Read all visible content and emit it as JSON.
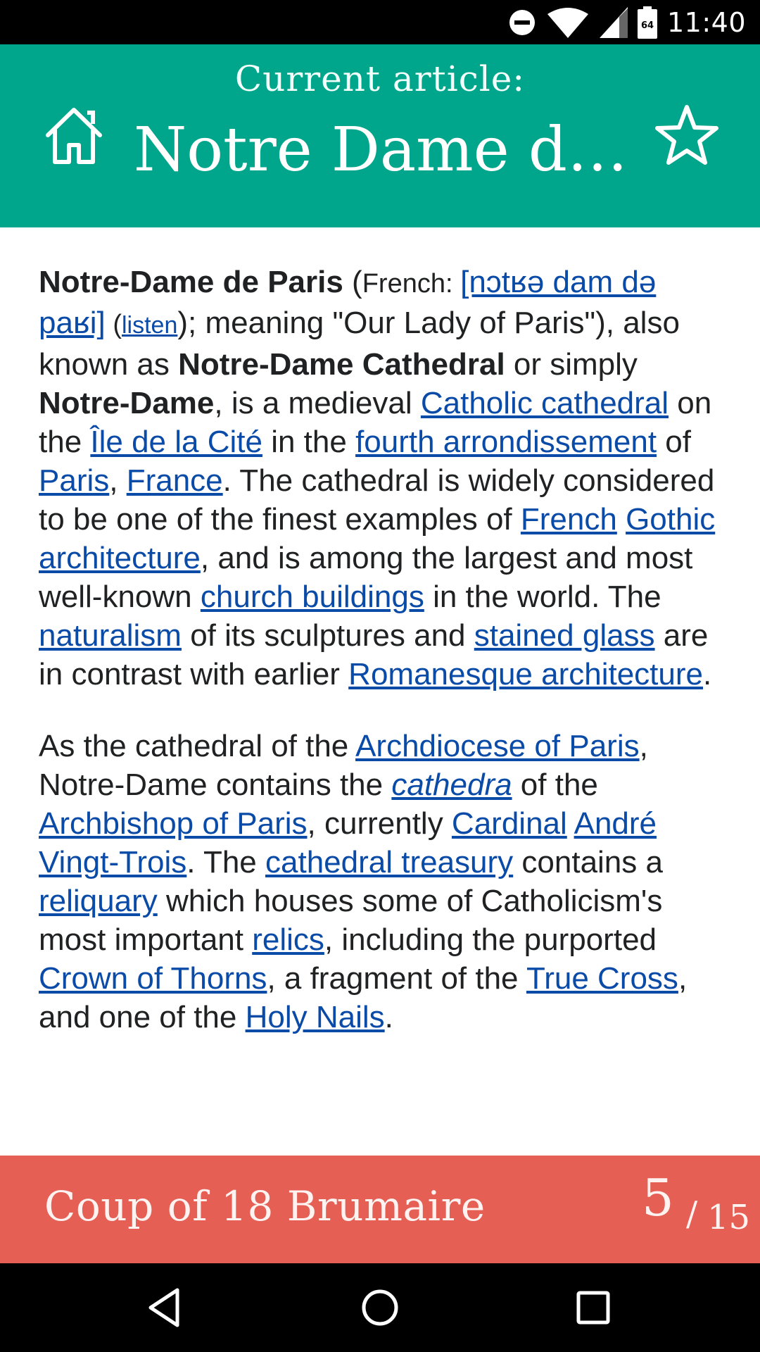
{
  "status_bar": {
    "time": "11:40",
    "icons": [
      "do-not-disturb-icon",
      "wifi-icon",
      "cell-signal-icon",
      "battery-icon"
    ],
    "battery_level": "64"
  },
  "header": {
    "subtitle": "Current article:",
    "title": "Notre Dame de ...",
    "color": "#00a68c",
    "home_icon": "home-icon",
    "favorite_icon": "star-icon"
  },
  "article": {
    "p1": {
      "s1": "Notre-Dame de Paris",
      "s2": " (",
      "s3": "French: ",
      "s4": "[nɔtʁə dam də paʁi]",
      "s5": " (",
      "s6": "listen",
      "s7": "); meaning \"Our Lady of Paris\"), also known as ",
      "s8": "Notre-Dame Cathedral",
      "s9": " or simply ",
      "s10": "Notre-Dame",
      "s11": ", is a medieval ",
      "s12": "Catholic cathedral",
      "s13": " on the ",
      "s14": "Île de la Cité",
      "s15": " in the ",
      "s16": "fourth arrondissement",
      "s17": " of ",
      "s18": "Paris",
      "s19": ", ",
      "s20": "France",
      "s21": ". The cathedral is widely considered to be one of the finest examples of ",
      "s22": "French",
      "s23": " ",
      "s24": "Gothic architecture",
      "s25": ", and is among the largest and most well-known ",
      "s26": "church buildings",
      "s27": " in the world. The ",
      "s28": "naturalism",
      "s29": " of its sculptures and ",
      "s30": "stained glass",
      "s31": " are in contrast with earlier ",
      "s32": "Romanesque architecture",
      "s33": "."
    },
    "p2": {
      "s1": "As the cathedral of the ",
      "s2": "Archdiocese of Paris",
      "s3": ", Notre-Dame contains the ",
      "s4": "cathedra",
      "s5": " of the ",
      "s6": "Archbishop of Paris",
      "s7": ", currently ",
      "s8": "Cardinal",
      "s9": " ",
      "s10": "André Vingt-Trois",
      "s11": ". The ",
      "s12": "cathedral treasury",
      "s13": " contains a ",
      "s14": "reliquary",
      "s15": " which houses some of Catholicism's most important ",
      "s16": "relics",
      "s17": ", including the purported ",
      "s18": "Crown of Thorns",
      "s19": ", a fragment of the ",
      "s20": "True Cross",
      "s21": ", and one of the ",
      "s22": "Holy Nails",
      "s23": "."
    },
    "link_color": "#0b4ba8"
  },
  "footer": {
    "target_title": "Coup of 18 Brumaire",
    "current": "5",
    "separator": "/",
    "total": "15",
    "color": "#e55f55"
  },
  "nav_bar": {
    "icons": [
      "back-icon",
      "home-circle-icon",
      "recents-icon"
    ]
  }
}
